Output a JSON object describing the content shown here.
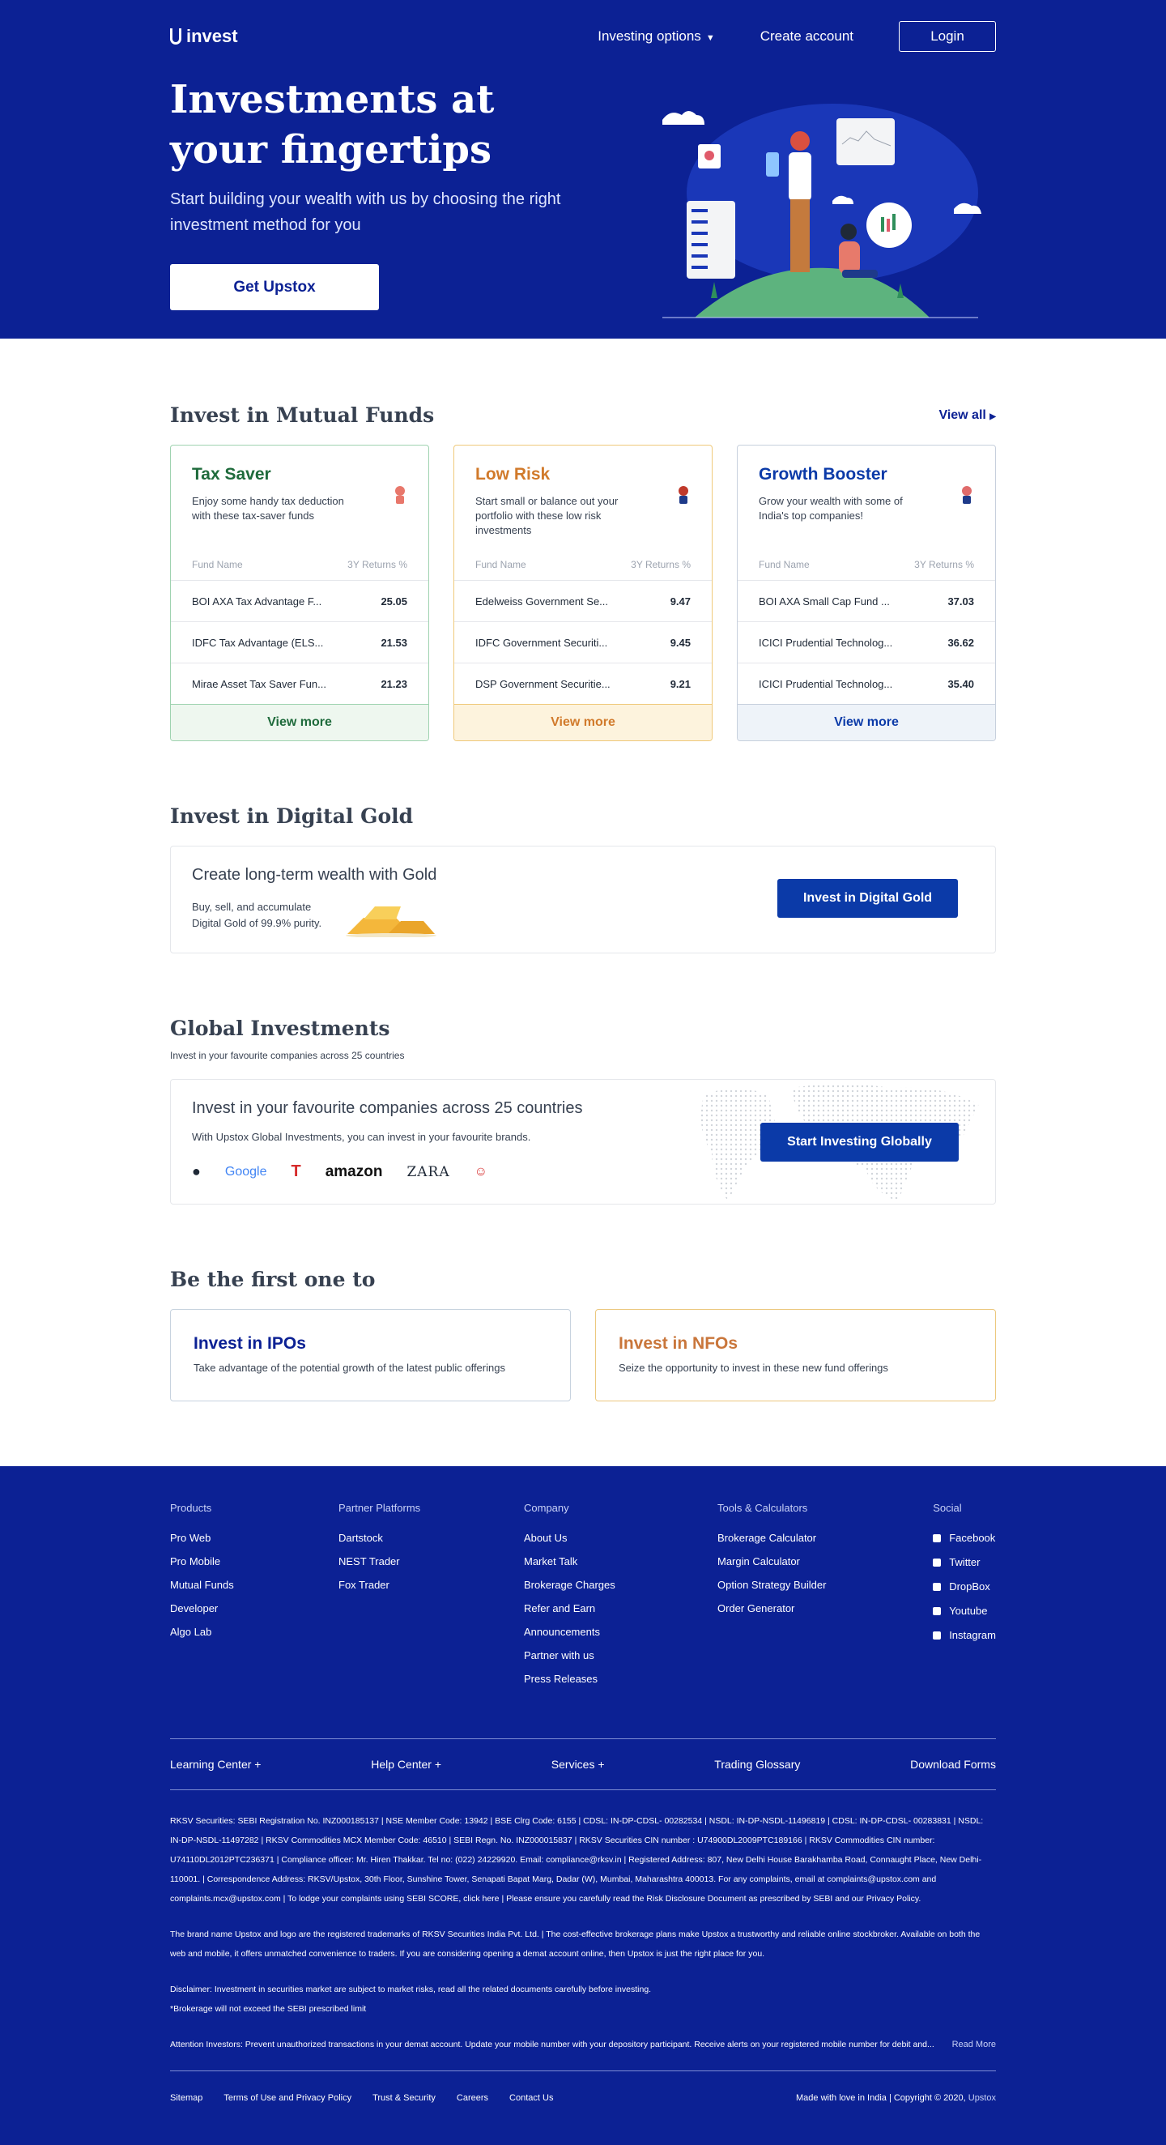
{
  "nav": {
    "logo": "invest",
    "investing_options": "Investing options",
    "create_account": "Create account",
    "login": "Login"
  },
  "hero": {
    "title": "Investments at your fingertips",
    "subtitle": "Start building your wealth with us by choosing the right investment method for you",
    "cta": "Get Upstox"
  },
  "mutual_funds": {
    "title": "Invest in Mutual Funds",
    "view_all": "View all",
    "col_name": "Fund Name",
    "col_returns": "3Y Returns %",
    "cards": [
      {
        "title": "Tax Saver",
        "desc": "Enjoy some handy tax deduction with these tax-saver funds",
        "color": "#1f6b3c",
        "border": "#9fd3b0",
        "foot_bg": "#eef7ef",
        "icon": "plant-pot-icon",
        "rows": [
          {
            "name": "BOI AXA Tax Advantage F...",
            "ret": "25.05"
          },
          {
            "name": "IDFC Tax Advantage (ELS...",
            "ret": "21.53"
          },
          {
            "name": "Mirae Asset Tax Saver Fun...",
            "ret": "21.23"
          }
        ],
        "more": "View more"
      },
      {
        "title": "Low Risk",
        "desc": "Start small or balance out your portfolio with these low risk investments",
        "color": "#d17a2b",
        "border": "#efc97a",
        "foot_bg": "#fdf3dd",
        "icon": "safety-badge-icon",
        "rows": [
          {
            "name": "Edelweiss Government Se...",
            "ret": "9.47"
          },
          {
            "name": "IDFC Government Securiti...",
            "ret": "9.45"
          },
          {
            "name": "DSP Government Securitie...",
            "ret": "9.21"
          }
        ],
        "more": "View more"
      },
      {
        "title": "Growth Booster",
        "desc": "Grow your wealth with some of India's top companies!",
        "color": "#0b3aa8",
        "border": "#c7d0dd",
        "foot_bg": "#eef3f9",
        "icon": "rocket-icon",
        "rows": [
          {
            "name": "BOI AXA Small Cap Fund ...",
            "ret": "37.03"
          },
          {
            "name": "ICICI Prudential Technolog...",
            "ret": "36.62"
          },
          {
            "name": "ICICI Prudential Technolog...",
            "ret": "35.40"
          }
        ],
        "more": "View more"
      }
    ]
  },
  "gold": {
    "title": "Invest in Digital Gold",
    "heading": "Create long-term wealth with Gold",
    "sub": "Buy, sell, and accumulate Digital Gold of 99.9% purity.",
    "button": "Invest in Digital Gold"
  },
  "global": {
    "title": "Global Investments",
    "subtitle": "Invest in your favourite companies across 25 countries",
    "heading": "Invest in your favourite companies across 25 countries",
    "sub": "With Upstox Global Investments, you can invest in your favourite brands.",
    "button": "Start Investing Globally",
    "brands": [
      "apple-logo",
      "Google",
      "tesla-logo",
      "amazon",
      "ZARA",
      "hello-kitty-logo"
    ],
    "brand_google": "Google",
    "brand_amazon": "amazon",
    "brand_zara": "ZARA"
  },
  "first": {
    "title": "Be the first one to",
    "ipo_title": "Invest in IPOs",
    "ipo_desc": "Take advantage of the potential growth of the latest public offerings",
    "nfo_title": "Invest in NFOs",
    "nfo_desc": "Seize the opportunity to invest in these new fund offerings"
  },
  "footer": {
    "products": {
      "h": "Products",
      "items": [
        "Pro Web",
        "Pro Mobile",
        "Mutual Funds",
        "Developer",
        "Algo Lab"
      ]
    },
    "partners": {
      "h": "Partner Platforms",
      "items": [
        "Dartstock",
        "NEST Trader",
        "Fox Trader"
      ]
    },
    "company": {
      "h": "Company",
      "items": [
        "About Us",
        "Market Talk",
        "Brokerage Charges",
        "Refer and Earn",
        "Announcements",
        "Partner with us",
        "Press Releases"
      ]
    },
    "tools": {
      "h": "Tools & Calculators",
      "items": [
        "Brokerage Calculator",
        "Margin Calculator",
        "Option Strategy Builder",
        "Order Generator"
      ]
    },
    "social": {
      "h": "Social",
      "items": [
        "Facebook",
        "Twitter",
        "DropBox",
        "Youtube",
        "Instagram"
      ]
    },
    "links2": [
      "Learning Center +",
      "Help Center +",
      "Services +",
      "Trading Glossary",
      "Download Forms"
    ],
    "legal1": "RKSV Securities: SEBI Registration No. INZ000185137 | NSE Member Code: 13942 | BSE Clrg Code: 6155 | CDSL: IN-DP-CDSL- 00282534 | NSDL: IN-DP-NSDL-11496819 | CDSL: IN-DP-CDSL- 00283831 | NSDL: IN-DP-NSDL-11497282 | RKSV Commodities MCX Member Code: 46510 | SEBI Regn. No. INZ000015837 | RKSV Securities CIN number : U74900DL2009PTC189166 | RKSV Commodities CIN number: U74110DL2012PTC236371 | Compliance officer: Mr. Hiren Thakkar. Tel no: (022) 24229920. Email: compliance@rksv.in | Registered Address: 807, New Delhi House Barakhamba Road, Connaught Place, New Delhi-110001. | Correspondence Address: RKSV/Upstox, 30th Floor, Sunshine Tower, Senapati Bapat Marg, Dadar (W), Mumbai, Maharashtra 400013. For any complaints, email at complaints@upstox.com and complaints.mcx@upstox.com | To lodge your complaints using SEBI SCORE, click here | Please ensure you carefully read the Risk Disclosure Document as prescribed by SEBI and our Privacy Policy.",
    "legal2": "The brand name Upstox and logo are the registered trademarks of RKSV Securities India Pvt. Ltd. | The cost-effective brokerage plans make Upstox a trustworthy and reliable online stockbroker. Available on both the web and mobile, it offers unmatched convenience to traders. If you are considering opening a demat account online, then Upstox is just the right place for you.",
    "disclaimer1": "Disclaimer: Investment in securities market are subject to market risks, read all the related documents carefully before investing.",
    "disclaimer2": "*Brokerage will not exceed the SEBI prescribed limit",
    "attention": "Attention Investors: Prevent unauthorized transactions in your demat account. Update your mobile number with your depository participant. Receive alerts on your registered mobile number for debit and...",
    "read_more": "Read More",
    "bottom_links": [
      "Sitemap",
      "Terms of Use and Privacy Policy",
      "Trust & Security",
      "Careers",
      "Contact Us"
    ],
    "copyright": "Made with love in India | Copyright © 2020,",
    "copyright_brand": "Upstox"
  }
}
